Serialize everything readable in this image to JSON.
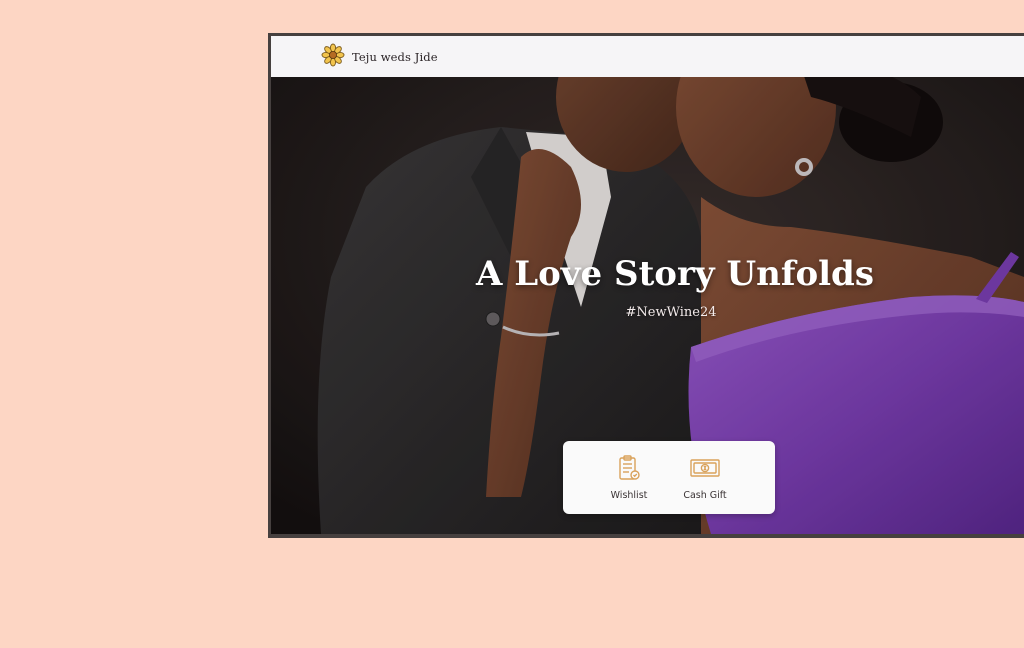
{
  "navbar": {
    "brand_icon": "flower-icon",
    "brand_title": "Teju weds Jide"
  },
  "hero": {
    "title": "A Love Story Unfolds",
    "hashtag": "#NewWine24"
  },
  "gift_options": [
    {
      "label": "Wishlist",
      "icon": "clipboard-list-icon"
    },
    {
      "label": "Cash Gift",
      "icon": "banknote-icon"
    }
  ],
  "colors": {
    "page_background": "#fdd6c4",
    "accent_gold": "#d9a25b",
    "dress_purple": "#7c3fb4",
    "navbar_background": "#f6f5f7"
  }
}
